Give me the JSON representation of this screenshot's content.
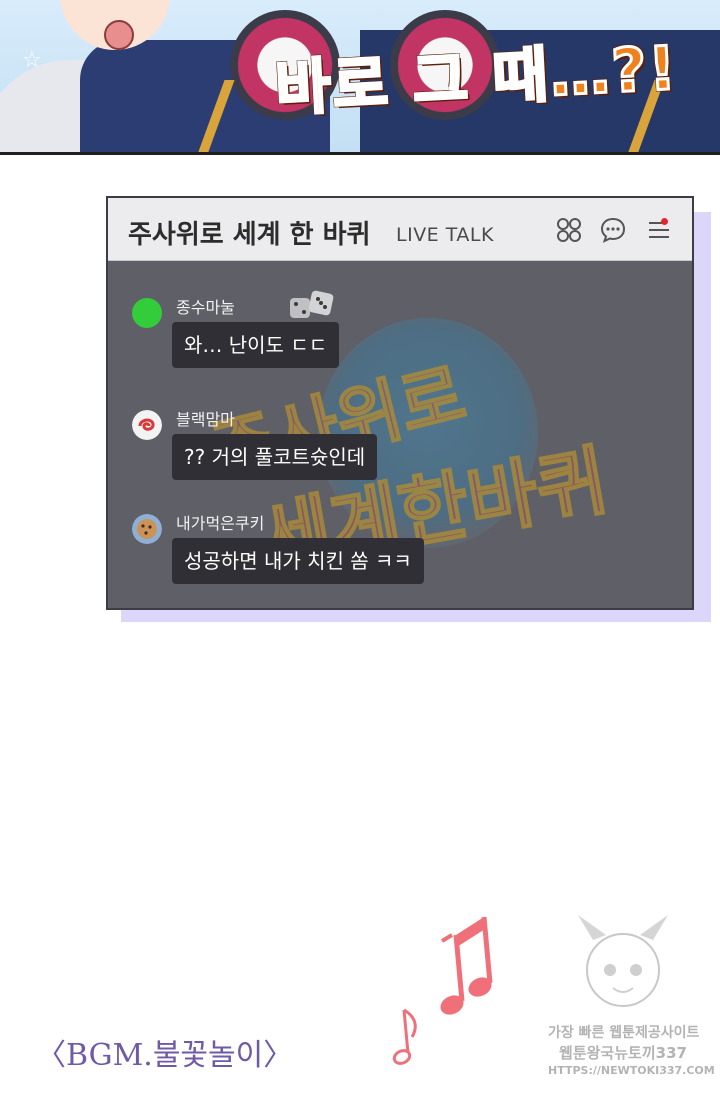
{
  "panel": {
    "shout": "바로 그 때…?!"
  },
  "live_talk": {
    "title": "주사위로 세계 한 바퀴",
    "subtitle": "LIVE TALK",
    "watermark_line1": "주사위로",
    "watermark_line2": "세계한바퀴",
    "messages": [
      {
        "user": "종수마눌",
        "text": "와… 난이도 ㄷㄷ",
        "avatar_color": "#33cc3a",
        "avatar_icon": "green-dot"
      },
      {
        "user": "블랙맘마",
        "text": "?? 거의 풀코트슛인데",
        "avatar_color": "#d83a3a",
        "avatar_icon": "red-swirl"
      },
      {
        "user": "내가먹은쿠키",
        "text": "성공하면 내가 치킨 쏨 ㅋㅋ",
        "avatar_color": "#8fb0d6",
        "avatar_icon": "cookie"
      }
    ],
    "icons": [
      "grid-icon",
      "chat-bubble-icon",
      "menu-icon"
    ]
  },
  "bgm_caption": "〈BGM.불꽃놀이〉",
  "site_watermark": {
    "line1": "가장 빠른 웹툰제공사이트",
    "line2": "웹툰왕국뉴토끼337",
    "line3": "HTTPS://NEWTOKI337.COM"
  },
  "colors": {
    "talk_bg": "#5f5f68",
    "header_bg": "#ececef",
    "bubble_bg": "#2f2f35",
    "shadow": "#dcd6fb",
    "bgm_text": "#6f5aa8",
    "note": "#f0707a"
  }
}
